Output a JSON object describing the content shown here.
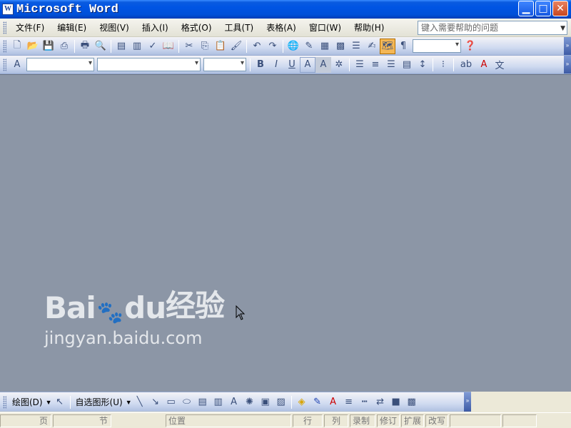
{
  "window": {
    "title": "Microsoft Word",
    "app_icon": "W",
    "minimize": "▁",
    "maximize": "□",
    "close": "✕"
  },
  "menu": {
    "items": [
      "文件(F)",
      "编辑(E)",
      "视图(V)",
      "插入(I)",
      "格式(O)",
      "工具(T)",
      "表格(A)",
      "窗口(W)",
      "帮助(H)"
    ],
    "help_placeholder": "键入需要帮助的问题"
  },
  "standard_toolbar": {
    "icons": [
      "new-document-icon",
      "open-icon",
      "save-icon",
      "permission-icon",
      "print-icon",
      "print-preview-icon",
      "research-icon",
      "thesaurus-icon",
      "spelling-icon",
      "translate-icon",
      "cut-icon",
      "copy-icon",
      "paste-icon",
      "format-painter-icon",
      "undo-icon",
      "redo-icon",
      "hyperlink-icon",
      "tables-borders-icon",
      "insert-table-icon",
      "insert-excel-icon",
      "columns-icon",
      "drawing-icon",
      "document-map-icon",
      "show-hide-icon",
      "zoom-icon",
      "help-icon"
    ]
  },
  "formatting_toolbar": {
    "style": "",
    "font": "",
    "size": "",
    "bold": "B",
    "italic": "I",
    "underline": "U",
    "char_border": "A",
    "char_shading": "A",
    "highlight": "ab",
    "font_color": "A"
  },
  "drawing_toolbar": {
    "draw_label": "绘图(D)",
    "autoshapes_label": "自选图形(U)"
  },
  "status": {
    "page": "页",
    "section": "节",
    "position": "位置",
    "line": "行",
    "column": "列",
    "rec": "录制",
    "trk": "修订",
    "ext": "扩展",
    "ovr": "改写"
  },
  "watermark": {
    "logo": "Bai du 经验",
    "logo_prefix": "Bai",
    "logo_suffix": "du",
    "logo_cn": "经验",
    "url": "jingyan.baidu.com"
  },
  "colors": {
    "titlebar": "#0054E3",
    "doc_background": "#8C96A6",
    "toolbar": "#CFDAF0",
    "active_button": "#F4B755"
  }
}
